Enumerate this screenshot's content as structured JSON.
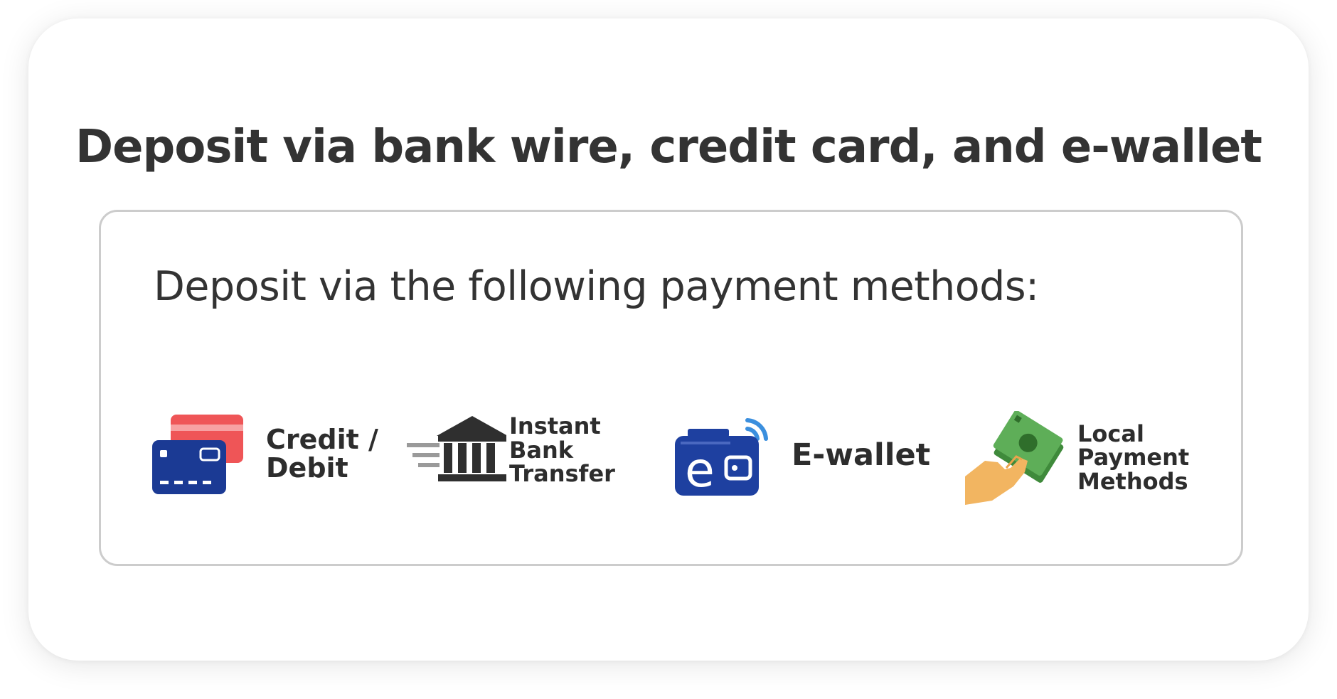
{
  "title": "Deposit via bank wire, credit card, and e-wallet",
  "subtitle": "Deposit via the following payment methods:",
  "methods": [
    {
      "label": "Credit /\nDebit",
      "icon": "credit-card-icon"
    },
    {
      "label": "Instant\nBank\nTransfer",
      "icon": "bank-icon"
    },
    {
      "label": "E-wallet",
      "icon": "e-wallet-icon"
    },
    {
      "label": "Local\nPayment\nMethods",
      "icon": "hand-cash-icon"
    }
  ],
  "colors": {
    "card_back": "#ef5557",
    "card_front": "#1b3a94",
    "bank": "#2f2f2f",
    "wallet": "#1e40a0",
    "wallet_signal": "#3b8fde",
    "cash": "#4f9e4a",
    "hand": "#f2b561",
    "text": "#333333"
  }
}
